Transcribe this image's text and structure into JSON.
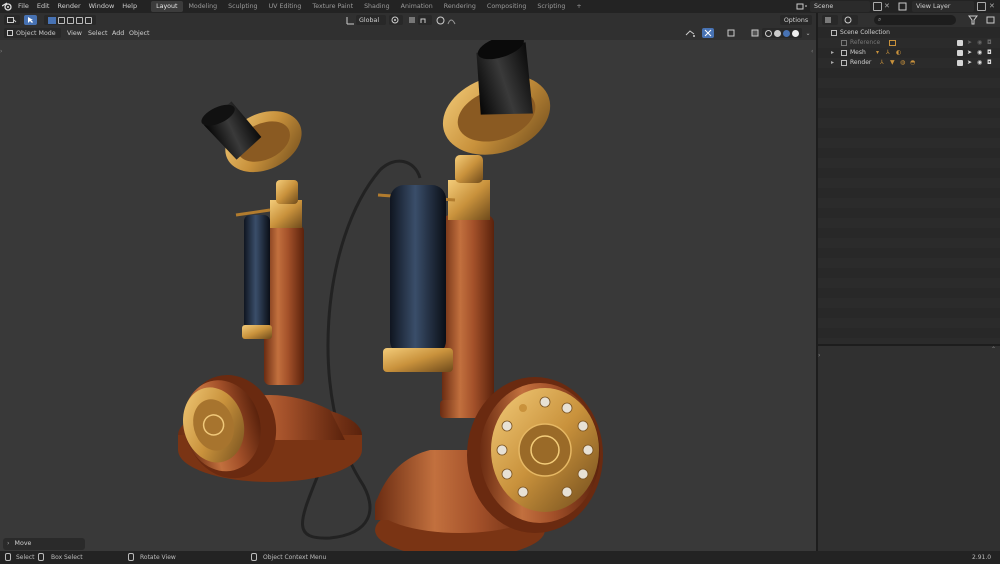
{
  "topbar": {
    "menus": [
      "File",
      "Edit",
      "Render",
      "Window",
      "Help"
    ],
    "workspaces": [
      "Layout",
      "Modeling",
      "Sculpting",
      "UV Editing",
      "Texture Paint",
      "Shading",
      "Animation",
      "Rendering",
      "Compositing",
      "Scripting"
    ],
    "active_workspace": "Layout",
    "add_tab": "+",
    "scene": "Scene",
    "view_layer": "View Layer"
  },
  "viewport_header": {
    "mode": "Object Mode",
    "menus": [
      "View",
      "Select",
      "Add",
      "Object"
    ],
    "orientation": "Global",
    "options": "Options"
  },
  "outliner": {
    "items": [
      {
        "label": "Scene Collection"
      },
      {
        "label": "Reference"
      },
      {
        "label": "Mesh"
      },
      {
        "label": "Render"
      }
    ]
  },
  "last_operator": "Move",
  "statusbar": {
    "select": "Select",
    "box_select": "Box Select",
    "rotate": "Rotate View",
    "context_menu": "Object Context Menu",
    "version": "2.91.0"
  },
  "colors": {
    "accent_blue": "#4772b3",
    "brass": "#c9923c",
    "wood": "#a4512a",
    "viewport_bg": "#393939"
  }
}
